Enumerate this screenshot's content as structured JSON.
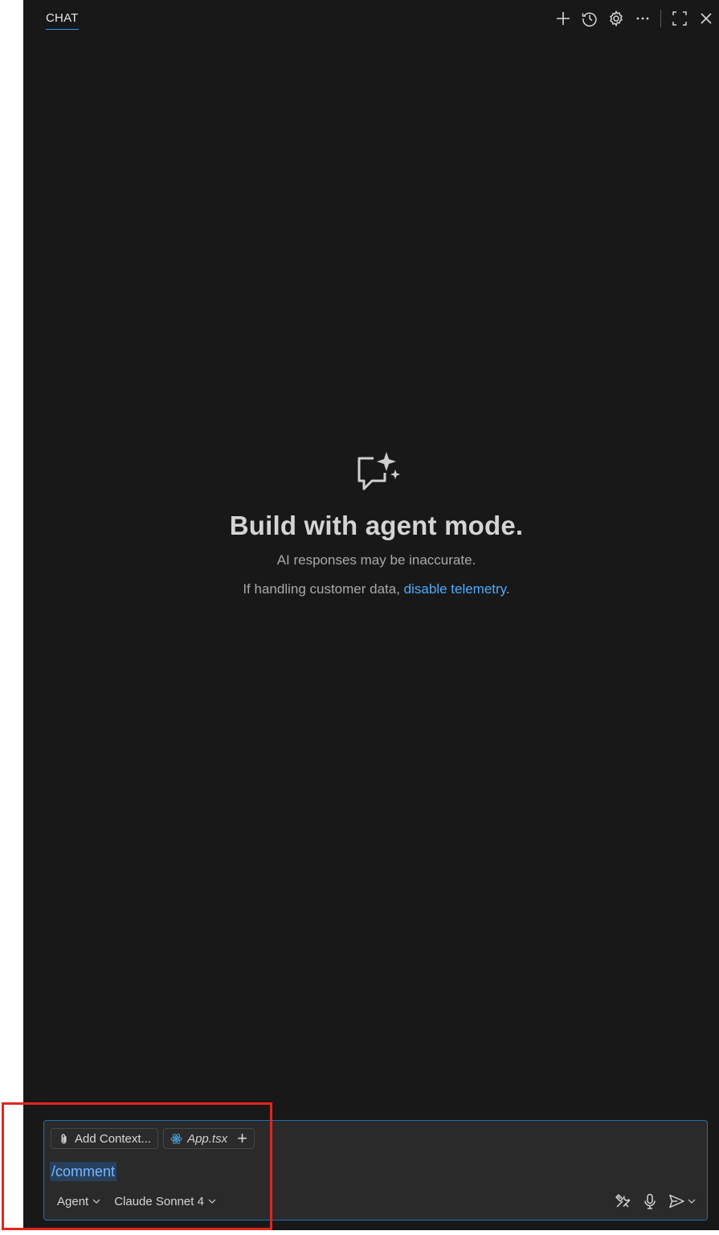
{
  "tab": {
    "label": "CHAT"
  },
  "toolbar": {
    "icons": [
      "plus-icon",
      "history-icon",
      "gear-icon",
      "more-icon",
      "maximize-icon",
      "close-icon"
    ]
  },
  "welcome": {
    "title": "Build with agent mode.",
    "subtitle": "AI responses may be inaccurate.",
    "telemetry_prefix": "If handling customer data, ",
    "telemetry_link": "disable telemetry",
    "telemetry_suffix": "."
  },
  "input": {
    "add_context_label": "Add Context...",
    "file_chip_label": "App.tsx",
    "typed_text": "/comment",
    "mode_label": "Agent",
    "model_label": "Claude Sonnet 4"
  },
  "colors": {
    "panel_bg": "#181818",
    "accent": "#3794ff",
    "link": "#4daafc",
    "highlight": "#e0261d"
  }
}
